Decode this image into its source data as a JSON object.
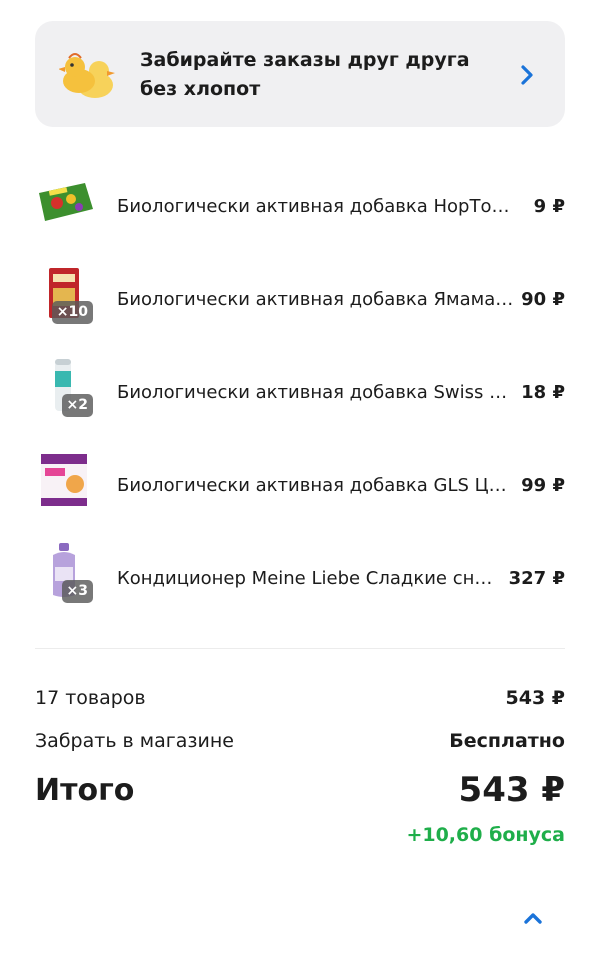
{
  "banner": {
    "text": "Забирайте заказы друг друга без хлопот",
    "icon": "ducks-icon",
    "chevron_icon": "chevron-right-icon"
  },
  "items": [
    {
      "name": "Биологически активная добавка НорТор …",
      "price": "9 ₽",
      "quantity": "",
      "thumb_icon": "candy-pack-thumbnail"
    },
    {
      "name": "Биологически активная добавка Ямама …",
      "price": "90 ₽",
      "quantity": "×10",
      "thumb_icon": "red-box-thumbnail"
    },
    {
      "name": "Биологически активная добавка Swiss En…",
      "price": "18 ₽",
      "quantity": "×2",
      "thumb_icon": "tube-thumbnail"
    },
    {
      "name": "Биологически активная добавка GLS Ци…",
      "price": "99 ₽",
      "quantity": "",
      "thumb_icon": "white-box-thumbnail"
    },
    {
      "name": "Кондиционер Meine Liebe Сладкие сн…",
      "price": "327 ₽",
      "quantity": "×3",
      "thumb_icon": "bottle-thumbnail"
    }
  ],
  "summary": {
    "items_count_label": "17 товаров",
    "items_total": "543 ₽",
    "pickup_label": "Забрать в магазине",
    "pickup_value": "Бесплатно",
    "total_label": "Итого",
    "total_value": "543 ₽",
    "bonus": "+10,60 бонуса"
  },
  "colors": {
    "accent_blue": "#1a73d9",
    "bonus_green": "#1fae4a",
    "banner_bg": "#f0f0f2"
  }
}
